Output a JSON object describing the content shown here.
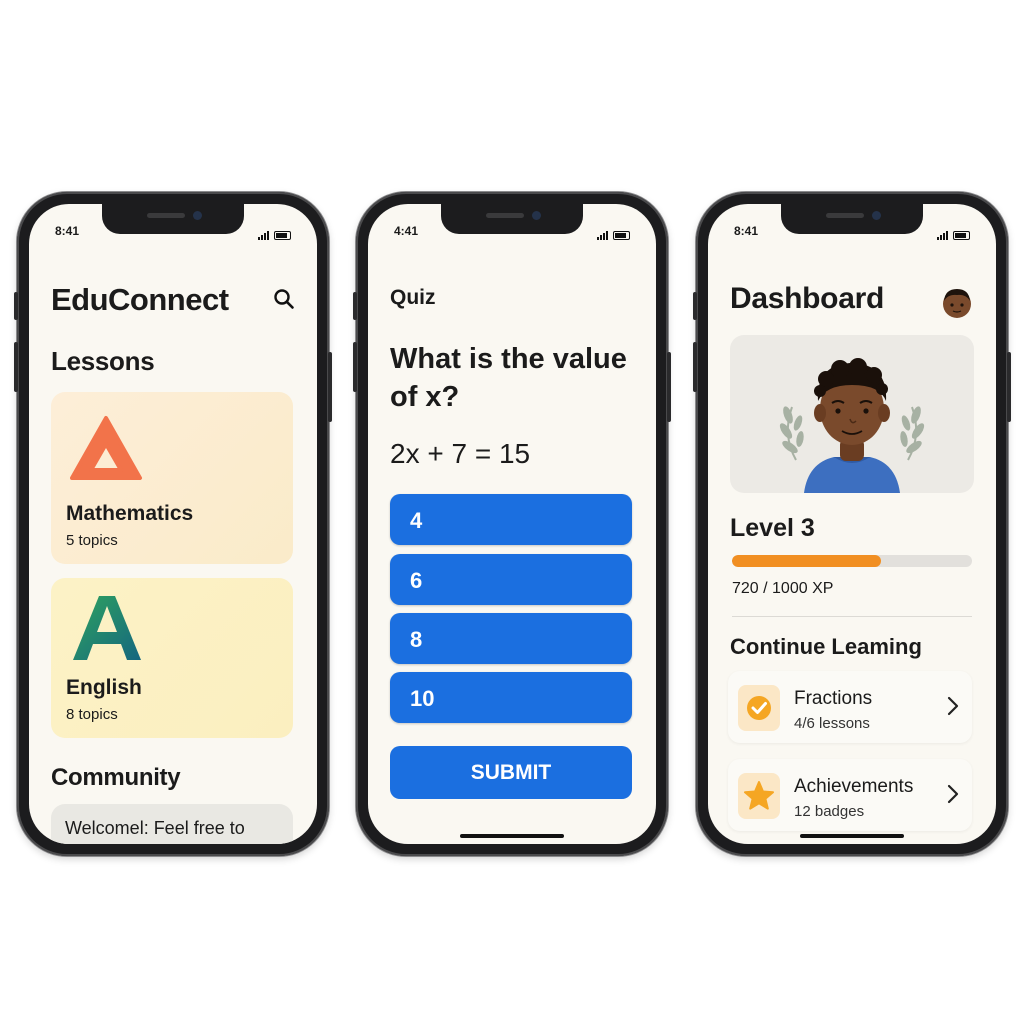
{
  "phones": [
    {
      "status_time": "8:41",
      "app_title": "EduConnect",
      "section_lessons": "Lessons",
      "lessons": [
        {
          "title": "Mathematics",
          "topics": "5 topics",
          "icon": "triangle-icon",
          "icon_color": "#f2734a",
          "bg": "#fcebd2"
        },
        {
          "title": "English",
          "topics": "8 topics",
          "icon": "letter-a-icon",
          "icon_color": "#1e7f8a",
          "bg": "#fcf1c4"
        }
      ],
      "section_community": "Community",
      "community_post": "Welcomel: Feel free to"
    },
    {
      "status_time": "4:41",
      "header": "Quiz",
      "question": "What is the value of x?",
      "equation": "2x + 7 = 15",
      "answers": [
        "4",
        "6",
        "8",
        "10"
      ],
      "submit_label": "SUBMIT",
      "accent": "#1b6fe0"
    },
    {
      "status_time": "8:41",
      "title": "Dashboard",
      "level": "Level 3",
      "xp_progress": 0.62,
      "xp_text": "720 / 1000 XP",
      "continue_heading": "Continue Leaming",
      "items": [
        {
          "title": "Fractions",
          "subtitle": "4/6 lessons",
          "icon": "check-circle-icon"
        },
        {
          "title": "Achievements",
          "subtitle": "12 badges",
          "icon": "star-icon"
        }
      ],
      "accent_orange": "#f18f22"
    }
  ]
}
